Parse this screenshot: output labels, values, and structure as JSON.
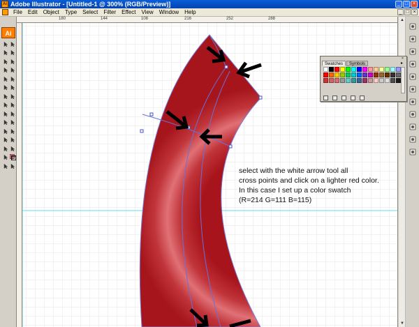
{
  "window": {
    "title": "Adobe Illustrator - [Untitled-1 @ 300% (RGB/Preview)]"
  },
  "menu": {
    "items": [
      "File",
      "Edit",
      "Object",
      "Type",
      "Select",
      "Filter",
      "Effect",
      "View",
      "Window",
      "Help"
    ]
  },
  "toolbox": {
    "logo": "Ai"
  },
  "ruler": {
    "top_numbers": [
      "180",
      "144",
      "108",
      "216",
      "252",
      "288"
    ]
  },
  "swatches_panel": {
    "tabs": [
      "Swatches",
      "Symbols"
    ],
    "active_tab": "Swatches",
    "colors": [
      "#ffffff",
      "#000000",
      "#ff0000",
      "#ffff00",
      "#00ff00",
      "#00ffff",
      "#0000ff",
      "#ff00ff",
      "#ff9999",
      "#ffcc99",
      "#ffff99",
      "#99ff99",
      "#99ffff",
      "#9999ff",
      "#ff0000",
      "#ff6600",
      "#ffcc00",
      "#99cc00",
      "#00cc66",
      "#00cccc",
      "#0066ff",
      "#6633cc",
      "#cc00cc",
      "#993300",
      "#996633",
      "#663300",
      "#333333",
      "#666666",
      "#cc3333",
      "#cc6666",
      "#d66f73",
      "#999999",
      "#66cccc",
      "#339999",
      "#336699",
      "#993366",
      "#cc9999",
      "#ffcccc",
      "#cccccc",
      "#e0e0e0",
      "#4d4d4d",
      "#1a1a1a"
    ]
  },
  "annotation": {
    "lines": [
      "select with the white arrow tool all",
      "cross points and click on a lighter red color.",
      "In this case I set up a color swatch",
      "(R=214 G=111 B=115)"
    ]
  },
  "colors": {
    "shape_dark": "#a5151b",
    "shape_light": "#e07176",
    "guide": "#5ce1f0",
    "path": "#6a6fd8"
  }
}
